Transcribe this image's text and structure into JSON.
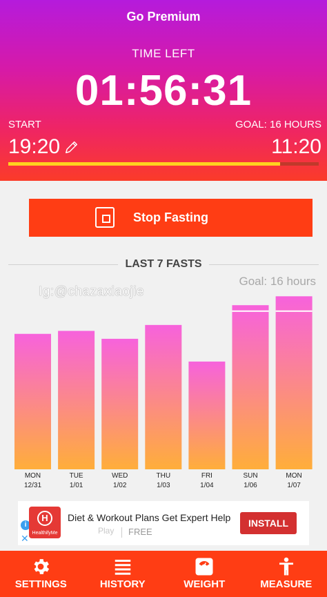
{
  "header": {
    "premium_label": "Go Premium",
    "time_left_label": "TIME LEFT",
    "timer": "01:56:31",
    "start_label": "START",
    "goal_label": "GOAL: 16 HOURS",
    "start_time": "19:20",
    "end_time": "11:20",
    "progress": 0.876
  },
  "actions": {
    "stop_label": "Stop Fasting"
  },
  "fasts": {
    "title": "LAST 7 FASTS",
    "watermark": "Ig:@chazaxiaojie",
    "goal_text": "Goal: 16 hours"
  },
  "chart_data": {
    "type": "bar",
    "categories": [
      "MON 12/31",
      "TUE 1/01",
      "WED 1/02",
      "THU 1/03",
      "FRI 1/04",
      "SUN 1/06",
      "MON 1/07"
    ],
    "days": [
      "MON",
      "TUE",
      "WED",
      "THU",
      "FRI",
      "SUN",
      "MON"
    ],
    "dates": [
      "12/31",
      "1/01",
      "1/02",
      "1/03",
      "1/04",
      "1/06",
      "1/07"
    ],
    "values": [
      13.7,
      14.0,
      13.2,
      14.6,
      10.9,
      16.6,
      17.5
    ],
    "goal": 16,
    "ylim": [
      0,
      17.8
    ],
    "colors": {
      "top": "#f762dc",
      "bottom": "#ffae3a",
      "goal_line": "#ffffff"
    }
  },
  "ad": {
    "info_icon": "i",
    "logo_mark": "H",
    "logo_text": "HealthifyMe",
    "text": "Diet & Workout Plans Get Expert Help",
    "sub": "Play",
    "free": "FREE",
    "install": "INSTALL"
  },
  "nav": {
    "items": [
      {
        "label": "SETTINGS",
        "icon": "gear-icon"
      },
      {
        "label": "HISTORY",
        "icon": "list-icon"
      },
      {
        "label": "WEIGHT",
        "icon": "scale-icon"
      },
      {
        "label": "MEASURE",
        "icon": "person-icon"
      }
    ]
  },
  "colors": {
    "accent": "#ff3d14",
    "progress_fill": "#ffd21f",
    "install": "#d33030"
  }
}
